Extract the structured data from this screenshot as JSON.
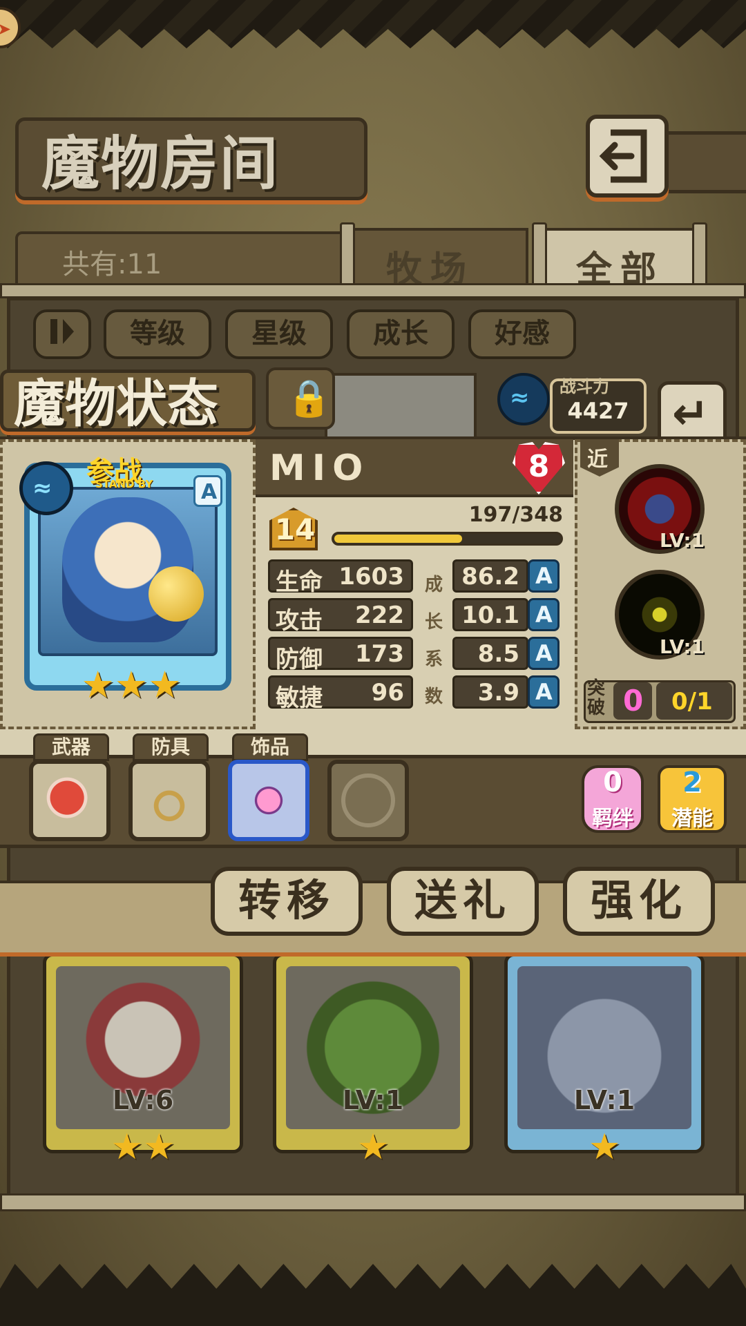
{
  "header": {
    "title": "魔物房间",
    "corner_icon": "arrow-icon",
    "back_icon": "return-icon"
  },
  "list": {
    "count_label": "共有:11",
    "tabs": [
      {
        "label": "牧场",
        "active": false
      },
      {
        "label": "全部",
        "active": true
      }
    ],
    "sort_buttons": [
      {
        "label": "等级"
      },
      {
        "label": "星级"
      },
      {
        "label": "成长"
      },
      {
        "label": "好感"
      }
    ],
    "cards": [
      {
        "level": "LV:6",
        "stars": "★★",
        "color": "#c9b84a"
      },
      {
        "level": "LV:1",
        "stars": "★",
        "color": "#c9b84a"
      },
      {
        "level": "LV:1",
        "stars": "★",
        "color": "#7ab4d4"
      }
    ]
  },
  "modal": {
    "title": "魔物状态",
    "power_label": "战斗力",
    "power_value": "4427",
    "name": "MIO",
    "bond_level": "8",
    "standby_main": "参战",
    "standby_sub": "STAND BY",
    "grade": "A",
    "stars": "★★★",
    "level": "14",
    "exp_text": "197/348",
    "exp_fraction": 0.566,
    "stats": [
      {
        "name": "生命",
        "value": "1603",
        "growth": "86.2",
        "grade": "A"
      },
      {
        "name": "攻击",
        "value": "222",
        "growth": "10.1",
        "grade": "A"
      },
      {
        "name": "防御",
        "value": "173",
        "growth": "8.5",
        "grade": "A"
      },
      {
        "name": "敏捷",
        "value": "96",
        "growth": "3.9",
        "grade": "A"
      }
    ],
    "growth_label_chars": [
      "成",
      "长",
      "系",
      "数"
    ],
    "range_tag": "近",
    "skills": [
      {
        "level": "LV:1",
        "icon": "paw-icon"
      },
      {
        "level": "LV:1",
        "icon": "lightning-icon"
      }
    ],
    "breakthrough_label": "突破",
    "breakthrough_count": "0",
    "breakthrough_progress": "0/1",
    "equipment": [
      {
        "label": "武器",
        "icon": "meat-icon"
      },
      {
        "label": "防具",
        "icon": "helmet-icon"
      },
      {
        "label": "饰品",
        "icon": "heart-ring-icon"
      },
      {
        "label": "",
        "icon": "empty-slot-icon"
      }
    ],
    "bond_button": {
      "value": "0",
      "label": "羁绊"
    },
    "potential_button": {
      "value": "2",
      "label": "潜能"
    },
    "actions": [
      {
        "label": "转移"
      },
      {
        "label": "送礼"
      },
      {
        "label": "强化"
      }
    ]
  },
  "colors": {
    "accent_orange": "#c06a2a",
    "grade_blue": "#2b6e9a",
    "gold": "#f2b920"
  }
}
